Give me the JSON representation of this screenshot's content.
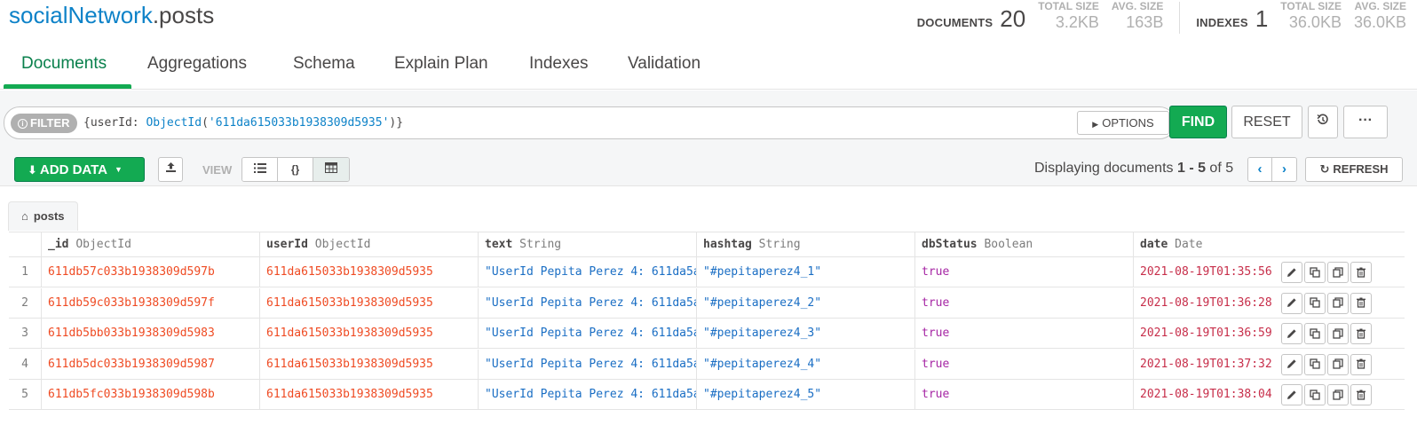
{
  "header": {
    "namespace_db": "socialNetwork",
    "namespace_coll": ".posts",
    "documents_label": "DOCUMENTS",
    "documents_count": "20",
    "doc_total_size_label": "TOTAL SIZE",
    "doc_total_size": "3.2KB",
    "doc_avg_size_label": "AVG. SIZE",
    "doc_avg_size": "163B",
    "indexes_label": "INDEXES",
    "indexes_count": "1",
    "idx_total_size_label": "TOTAL SIZE",
    "idx_total_size": "36.0KB",
    "idx_avg_size_label": "AVG. SIZE",
    "idx_avg_size": "36.0KB"
  },
  "tabs": [
    "Documents",
    "Aggregations",
    "Schema",
    "Explain Plan",
    "Indexes",
    "Validation"
  ],
  "query": {
    "filter_label": "FILTER",
    "filter_open": "{userId: ",
    "filter_fn": "ObjectId",
    "filter_paren_open": "(",
    "filter_arg": "'611da615033b1938309d5935'",
    "filter_close": ")}",
    "options_label": "OPTIONS",
    "find_label": "FIND",
    "reset_label": "RESET"
  },
  "toolbar": {
    "add_data_label": "ADD DATA",
    "view_label": "VIEW",
    "display_prefix": "Displaying documents ",
    "display_range": "1 - 5",
    "display_of": " of ",
    "display_total": "5",
    "refresh_label": "REFRESH"
  },
  "breadcrumb": "posts",
  "columns": [
    {
      "name": "_id",
      "type": "ObjectId"
    },
    {
      "name": "userId",
      "type": "ObjectId"
    },
    {
      "name": "text",
      "type": "String"
    },
    {
      "name": "hashtag",
      "type": "String"
    },
    {
      "name": "dbStatus",
      "type": "Boolean"
    },
    {
      "name": "date",
      "type": "Date"
    }
  ],
  "rows": [
    {
      "idx": "1",
      "_id": "611db57c033b1938309d597b",
      "userId": "611da615033b1938309d5935",
      "text": "\"UserId Pepita Perez 4: 611da5a",
      "hashtag": "\"#pepitaperez4_1\"",
      "dbStatus": "true",
      "date": "2021-08-19T01:35:56."
    },
    {
      "idx": "2",
      "_id": "611db59c033b1938309d597f",
      "userId": "611da615033b1938309d5935",
      "text": "\"UserId Pepita Perez 4: 611da5a",
      "hashtag": "\"#pepitaperez4_2\"",
      "dbStatus": "true",
      "date": "2021-08-19T01:36:28."
    },
    {
      "idx": "3",
      "_id": "611db5bb033b1938309d5983",
      "userId": "611da615033b1938309d5935",
      "text": "\"UserId Pepita Perez 4: 611da5a",
      "hashtag": "\"#pepitaperez4_3\"",
      "dbStatus": "true",
      "date": "2021-08-19T01:36:59."
    },
    {
      "idx": "4",
      "_id": "611db5dc033b1938309d5987",
      "userId": "611da615033b1938309d5935",
      "text": "\"UserId Pepita Perez 4: 611da5a",
      "hashtag": "\"#pepitaperez4_4\"",
      "dbStatus": "true",
      "date": "2021-08-19T01:37:32."
    },
    {
      "idx": "5",
      "_id": "611db5fc033b1938309d598b",
      "userId": "611da615033b1938309d5935",
      "text": "\"UserId Pepita Perez 4: 611da5a",
      "hashtag": "\"#pepitaperez4_5\"",
      "dbStatus": "true",
      "date": "2021-08-19T01:38:04."
    }
  ],
  "colors": {
    "brand_green": "#13aa52",
    "link_blue": "#0d82c8",
    "objectid": "#ef4b23",
    "string": "#1a6ec4",
    "boolean": "#a626a4",
    "date": "#c72e4a"
  }
}
